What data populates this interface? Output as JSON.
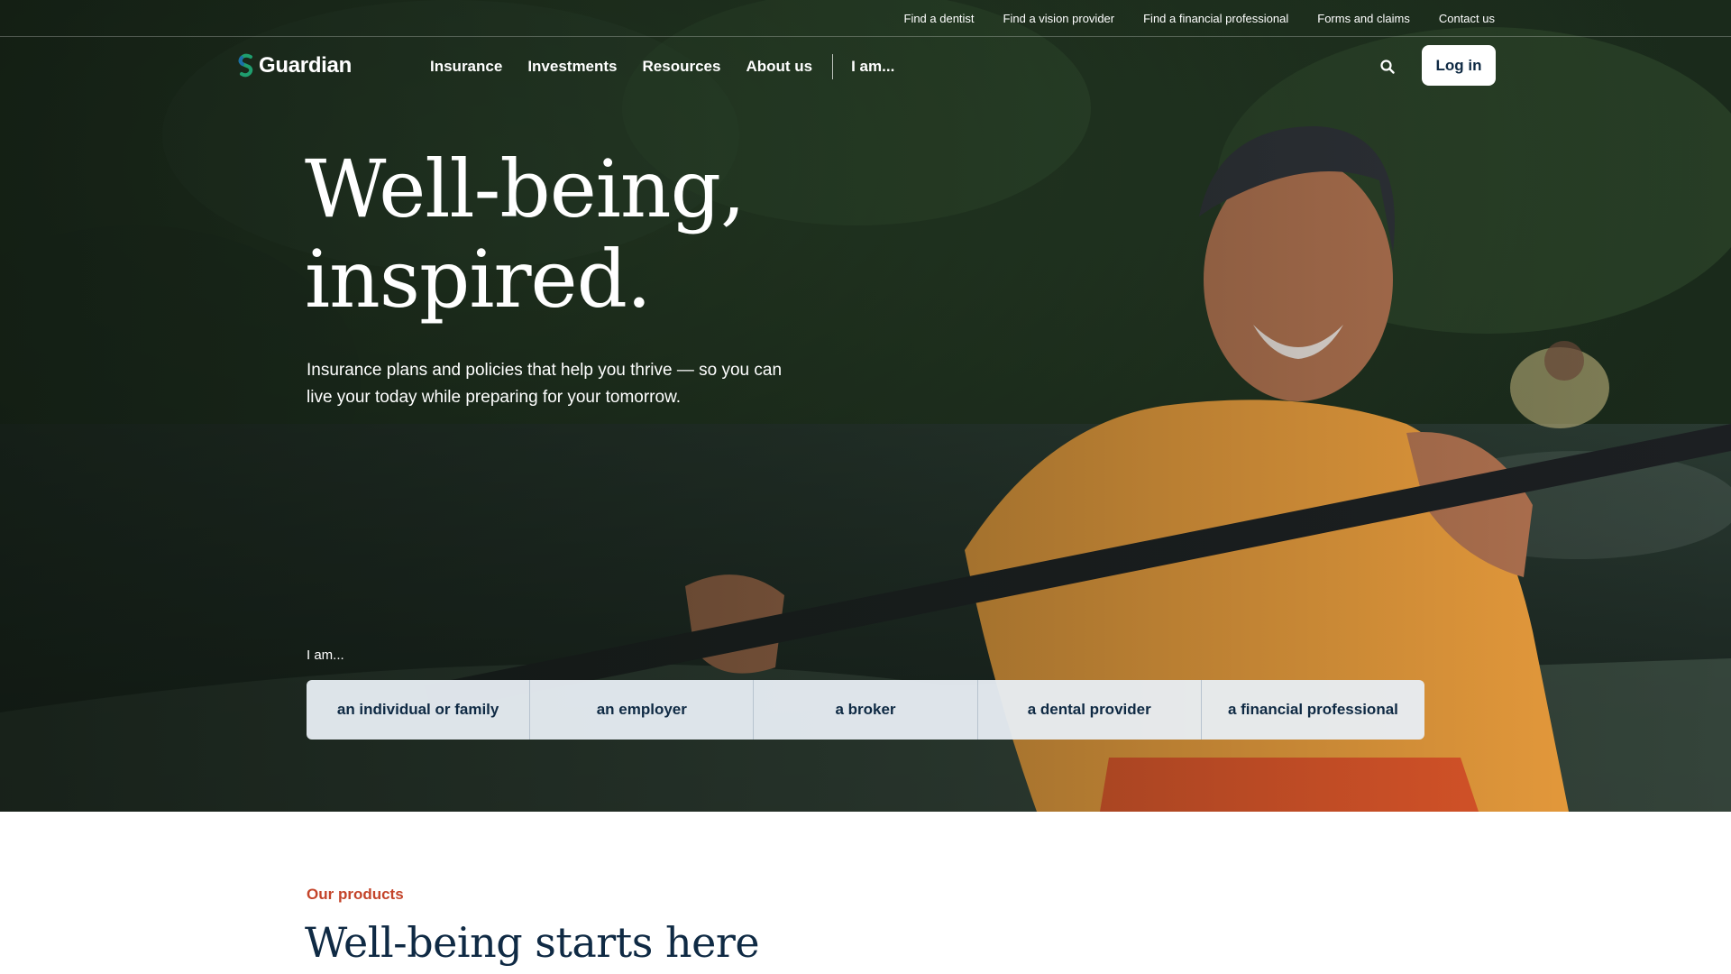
{
  "utility_nav": {
    "links": [
      "Find a dentist",
      "Find a vision provider",
      "Find a financial professional",
      "Forms and claims",
      "Contact us"
    ]
  },
  "header": {
    "logo_text": "Guardian",
    "nav": [
      "Insurance",
      "Investments",
      "Resources",
      "About us"
    ],
    "iam_menu": "I am...",
    "search_icon": "search-icon",
    "login_label": "Log in"
  },
  "hero": {
    "headline_line1": "Well-being,",
    "headline_line2": "inspired.",
    "subtext": "Insurance plans and policies that help you thrive — so you can live your today while preparing for your tomorrow.",
    "iam_label": "I am...",
    "audiences": [
      "an individual or family",
      "an employer",
      "a broker",
      "a dental provider",
      "a financial professional"
    ]
  },
  "products": {
    "eyebrow": "Our products",
    "title": "Well-being starts here"
  },
  "colors": {
    "navy": "#0f2a44",
    "accent_orange": "#c4442a",
    "logo_green": "#1f9e6e"
  }
}
